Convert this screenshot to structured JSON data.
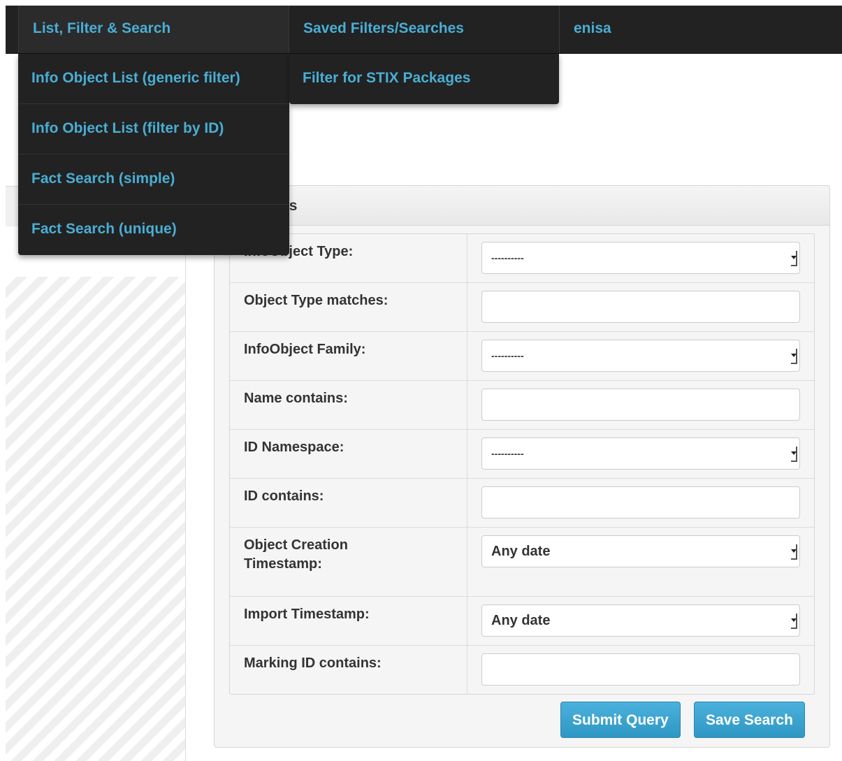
{
  "nav": {
    "items": [
      {
        "label": "List, Filter & Search"
      },
      {
        "label": "Saved Filters/Searches"
      },
      {
        "label": "enisa"
      }
    ]
  },
  "dropdown_list": {
    "items": [
      {
        "label": "Info Object List (generic filter)"
      },
      {
        "label": "Info Object List (filter by ID)"
      },
      {
        "label": "Fact Search (simple)"
      },
      {
        "label": "Fact Search (unique)"
      }
    ]
  },
  "dropdown_saved": {
    "items": [
      {
        "label": "Filter for STIX Packages"
      }
    ]
  },
  "panel": {
    "header": "arameters",
    "fields": [
      {
        "label": "InfoObject Type:",
        "type": "select",
        "value": "----------"
      },
      {
        "label": "Object Type matches:",
        "type": "input",
        "value": ""
      },
      {
        "label": "InfoObject Family:",
        "type": "select",
        "value": "----------"
      },
      {
        "label": "Name contains:",
        "type": "input",
        "value": ""
      },
      {
        "label": "ID Namespace:",
        "type": "select",
        "value": "----------"
      },
      {
        "label": "ID contains:",
        "type": "input",
        "value": ""
      },
      {
        "label": "Object Creation Timestamp:",
        "type": "select",
        "value": "Any date"
      },
      {
        "label": "Import Timestamp:",
        "type": "select",
        "value": "Any date"
      },
      {
        "label": "Marking ID contains:",
        "type": "input",
        "value": ""
      }
    ],
    "submit_label": "Submit Query",
    "save_label": "Save Search"
  },
  "colors": {
    "nav_bg": "#222222",
    "link": "#49aed4",
    "button": "#3aa3cf"
  }
}
